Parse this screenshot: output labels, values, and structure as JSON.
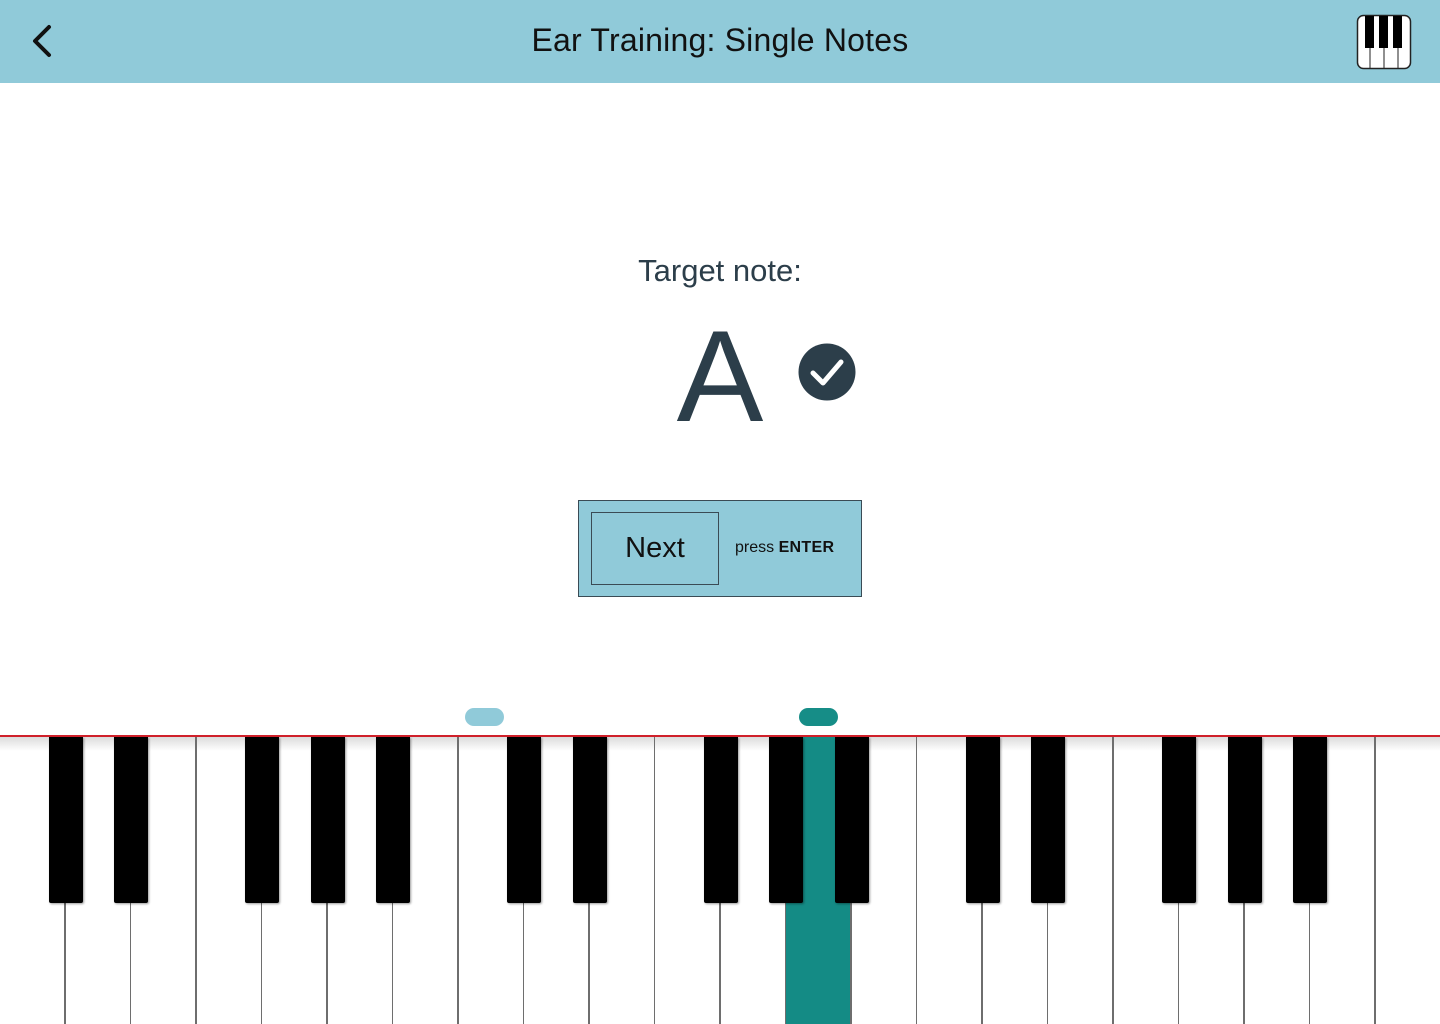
{
  "header": {
    "title": "Ear Training: Single Notes",
    "back_icon": "chevron-left-icon",
    "keyboard_icon": "piano-keyboard-icon"
  },
  "exercise": {
    "target_label": "Target note:",
    "target_note": "A",
    "result_icon": "check-circle-icon",
    "result": "correct"
  },
  "next": {
    "button_label": "Next",
    "hint_prefix": "press ",
    "hint_key": "ENTER"
  },
  "keyboard": {
    "white_key_count": 22,
    "active_white_key_index": 12,
    "black_key_pattern": [
      1,
      1,
      0,
      1,
      1,
      1,
      0
    ],
    "range_low_handle": "range-low-handle",
    "range_high_handle": "range-high-handle"
  },
  "colors": {
    "header_bg": "#90cad9",
    "text_dark": "#2c3e4a",
    "active_key": "#148b85",
    "accent_red": "#d0202a"
  }
}
